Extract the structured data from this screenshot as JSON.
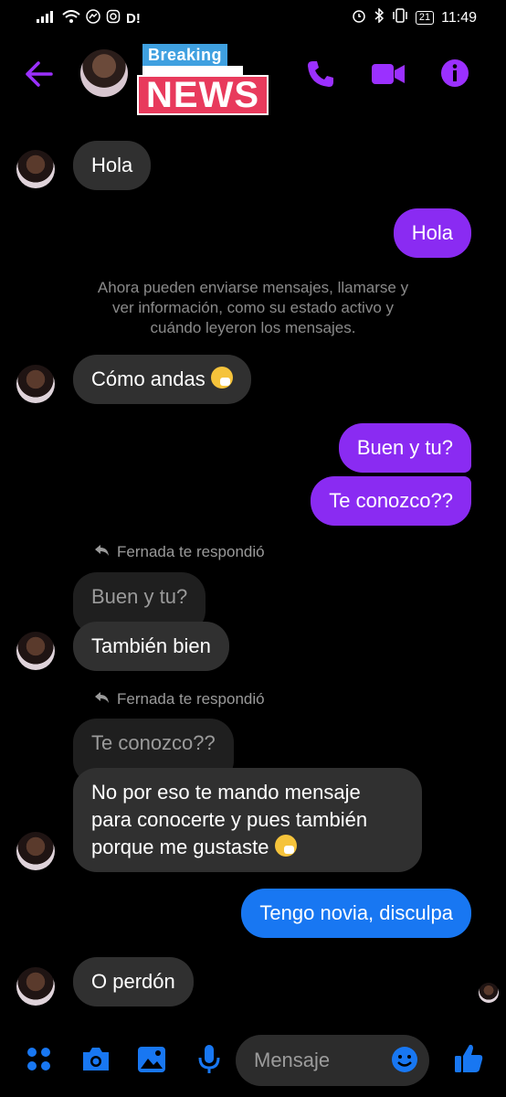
{
  "status_bar": {
    "left_text": "D!",
    "time": "11:49",
    "battery": "21"
  },
  "header": {
    "sticker_top": "Breaking",
    "sticker_bottom": "NEWS"
  },
  "messages": [
    {
      "from": "them",
      "text": "Hola"
    },
    {
      "from": "me",
      "text": "Hola"
    },
    {
      "from": "system",
      "lines": [
        "Ahora pueden enviarse mensajes, llamarse y",
        "ver información, como su estado activo y",
        "cuándo leyeron los mensajes."
      ]
    },
    {
      "from": "them",
      "text": "Cómo andas"
    },
    {
      "from": "me",
      "text": "Buen y tu?"
    },
    {
      "from": "me",
      "text": "Te conozco??"
    },
    {
      "from": "reply_note",
      "text": "Fernada te respondió"
    },
    {
      "from": "quoted",
      "text": "Buen y tu?"
    },
    {
      "from": "them",
      "text": "También bien"
    },
    {
      "from": "reply_note",
      "text": "Fernada te respondió"
    },
    {
      "from": "quoted",
      "text": "Te conozco??"
    },
    {
      "from": "them",
      "lines": [
        "No por eso te mando mensaje",
        "para conocerte y pues también",
        "porque me gustaste"
      ]
    },
    {
      "from": "me",
      "text": "Tengo novia, disculpa"
    },
    {
      "from": "them",
      "text": "O perdón"
    }
  ],
  "composer": {
    "placeholder": "Mensaje"
  },
  "colors": {
    "accent_purple": "#8a2bf2",
    "accent_blue": "#1877f2",
    "incoming_bubble": "#303030",
    "background": "#000000"
  },
  "icons": [
    "back-arrow-icon",
    "phone-icon",
    "video-icon",
    "info-icon",
    "menu-dots-icon",
    "camera-icon",
    "gallery-icon",
    "mic-icon",
    "emoji-icon",
    "thumbs-up-icon",
    "reply-arrow-icon"
  ]
}
